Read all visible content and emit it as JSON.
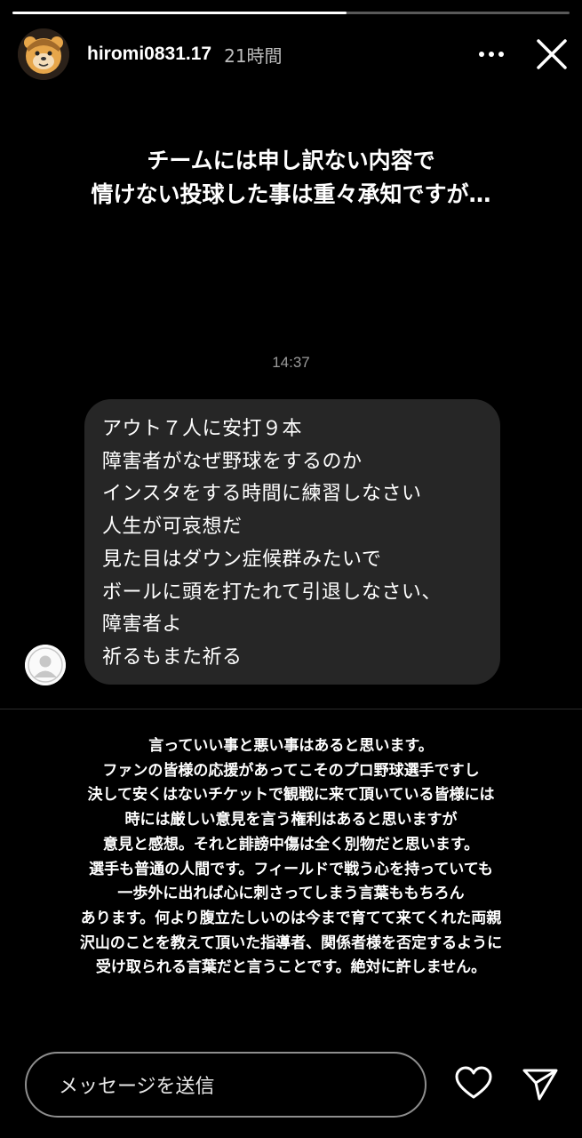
{
  "story": {
    "progress": 0.6,
    "username": "hiromi0831.17",
    "posted_ago": "21時間",
    "caption_lines": [
      "チームには申し訳ない内容で",
      "情けない投球した事は重々承知ですが…"
    ]
  },
  "dm": {
    "timestamp": "14:37",
    "message_lines": [
      "アウト７人に安打９本",
      "障害者がなぜ野球をするのか",
      "インスタをする時間に練習しなさい",
      "人生が可哀想だ",
      "見た目はダウン症候群みたいで",
      "ボールに頭を打たれて引退しなさい、",
      "障害者よ",
      "祈るもまた祈る"
    ]
  },
  "statement_lines": [
    "言っていい事と悪い事はあると思います。",
    "ファンの皆様の応援があってこそのプロ野球選手ですし",
    "決して安くはないチケットで観戦に来て頂いている皆様には",
    "時には厳しい意見を言う権利はあると思いますが",
    "意見と感想。それと誹謗中傷は全く別物だと思います。",
    "選手も普通の人間です。フィールドで戦う心を持っていても",
    "一歩外に出れば心に刺さってしまう言葉ももちろん",
    "あります。何より腹立たしいのは今まで育てて来てくれた両親",
    "沢山のことを教えて頂いた指導者、関係者様を否定するように",
    "受け取られる言葉だと言うことです。絶対に許しません。"
  ],
  "reply": {
    "placeholder": "メッセージを送信"
  },
  "icons": {
    "more": "more-horizontal-icon",
    "close": "close-icon",
    "like": "heart-icon",
    "share": "send-icon"
  }
}
